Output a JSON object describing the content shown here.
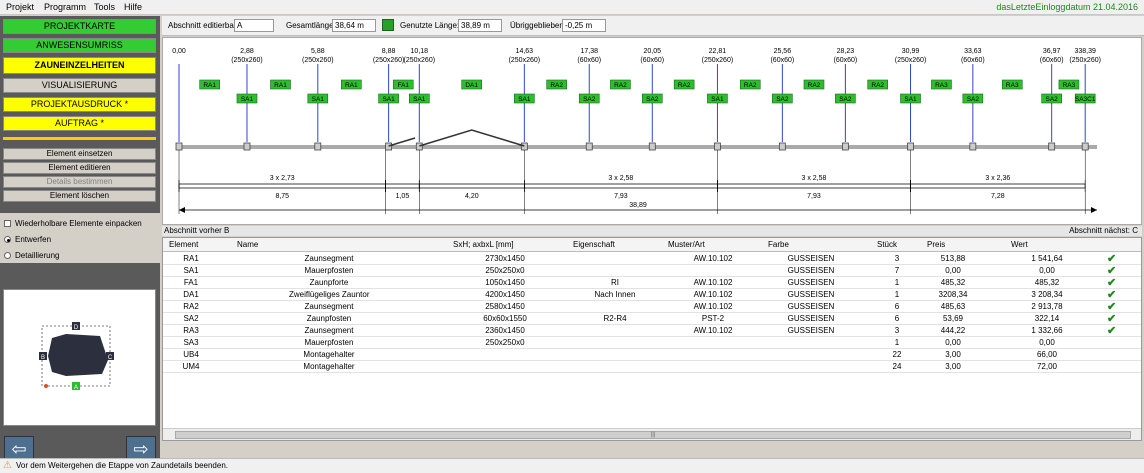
{
  "menu": [
    "Projekt",
    "Programm",
    "Tools",
    "Hilfe"
  ],
  "last_login": "dasLetzteEinloggdatum 21.04.2016",
  "nav": [
    {
      "label": "PROJEKTKARTE",
      "style": "green"
    },
    {
      "label": "ANWESENSUMRISS",
      "style": "green"
    },
    {
      "label": "ZAUNEINZELHEITEN",
      "style": "yellow"
    },
    {
      "label": "VISUALISIERUNG",
      "style": "gray"
    },
    {
      "label": "PROJEKTAUSDRUCK *",
      "style": "yellow"
    },
    {
      "label": "AUFTRAG *",
      "style": "yellow"
    }
  ],
  "actions": [
    {
      "label": "Element einsetzen",
      "disabled": false
    },
    {
      "label": "Element editieren",
      "disabled": false
    },
    {
      "label": "Details bestimmen",
      "disabled": true
    },
    {
      "label": "Element löschen",
      "disabled": false
    }
  ],
  "options": {
    "pack_label": "Wiederholbare Elemente einpacken",
    "draft_label": "Entwerfen",
    "detail_label": "Detaillierung"
  },
  "preview_labels": {
    "top": "D",
    "left": "B",
    "right": "C",
    "bottom": "A"
  },
  "toolbar": {
    "section_label": "Abschnitt editierbar:",
    "section_value": "A",
    "total_label": "Gesamtlänge:",
    "total_value": "38,64 m",
    "used_label": "Genutzte Länge:",
    "used_value": "38,89 m",
    "remaining_label": "Übriggeblieben",
    "remaining_value": "-0,25 m"
  },
  "drawing": {
    "posts": [
      {
        "x": 0.0,
        "label": "0,00",
        "size": ""
      },
      {
        "x": 2.88,
        "label": "2,88",
        "size": "(250x260)"
      },
      {
        "x": 5.88,
        "label": "5,88",
        "size": "(250x260)"
      },
      {
        "x": 8.88,
        "label": "8,88",
        "size": "(250x260)"
      },
      {
        "x": 10.18,
        "label": "10,18",
        "size": "(250x260)"
      },
      {
        "x": 14.63,
        "label": "14,63",
        "size": "(250x260)"
      },
      {
        "x": 17.38,
        "label": "17,38",
        "size": "(60x60)"
      },
      {
        "x": 20.05,
        "label": "20,05",
        "size": "(60x60)"
      },
      {
        "x": 22.81,
        "label": "22,81",
        "size": "(250x260)"
      },
      {
        "x": 25.56,
        "label": "25,56",
        "size": "(60x60)"
      },
      {
        "x": 28.23,
        "label": "28,23",
        "size": "(60x60)"
      },
      {
        "x": 30.99,
        "label": "30,99",
        "size": "(250x260)"
      },
      {
        "x": 33.63,
        "label": "33,63",
        "size": "(60x60)"
      },
      {
        "x": 36.97,
        "label": "36,97",
        "size": "(60x60)"
      },
      {
        "x": 38.39,
        "label": "338,39",
        "size": "(250x260)"
      }
    ],
    "elements": [
      {
        "x": 1.3,
        "row": 0,
        "label": "RA1"
      },
      {
        "x": 2.88,
        "row": 1,
        "label": "SA1"
      },
      {
        "x": 4.3,
        "row": 0,
        "label": "RA1"
      },
      {
        "x": 5.88,
        "row": 1,
        "label": "SA1"
      },
      {
        "x": 7.3,
        "row": 0,
        "label": "RA1"
      },
      {
        "x": 8.88,
        "row": 1,
        "label": "SA1"
      },
      {
        "x": 9.5,
        "row": 0,
        "label": "FA1"
      },
      {
        "x": 10.18,
        "row": 1,
        "label": "SA1"
      },
      {
        "x": 12.4,
        "row": 0,
        "label": "DA1"
      },
      {
        "x": 14.63,
        "row": 1,
        "label": "SA1"
      },
      {
        "x": 16.0,
        "row": 0,
        "label": "RA2"
      },
      {
        "x": 17.38,
        "row": 1,
        "label": "SA2"
      },
      {
        "x": 18.7,
        "row": 0,
        "label": "RA2"
      },
      {
        "x": 20.05,
        "row": 1,
        "label": "SA2"
      },
      {
        "x": 21.4,
        "row": 0,
        "label": "RA2"
      },
      {
        "x": 22.81,
        "row": 1,
        "label": "SA1"
      },
      {
        "x": 24.2,
        "row": 0,
        "label": "RA2"
      },
      {
        "x": 25.56,
        "row": 1,
        "label": "SA2"
      },
      {
        "x": 26.9,
        "row": 0,
        "label": "RA2"
      },
      {
        "x": 28.23,
        "row": 1,
        "label": "SA2"
      },
      {
        "x": 29.6,
        "row": 0,
        "label": "RA2"
      },
      {
        "x": 30.99,
        "row": 1,
        "label": "SA1"
      },
      {
        "x": 32.3,
        "row": 0,
        "label": "RA3"
      },
      {
        "x": 33.63,
        "row": 1,
        "label": "SA2"
      },
      {
        "x": 35.3,
        "row": 0,
        "label": "RA3"
      },
      {
        "x": 36.97,
        "row": 1,
        "label": "SA2"
      },
      {
        "x": 37.7,
        "row": 0,
        "label": "RA3"
      },
      {
        "x": 38.39,
        "row": 1,
        "label": "SA3C1"
      }
    ],
    "dims_row1": [
      {
        "from": 0.0,
        "to": 8.75,
        "label": "3 x 2,73"
      },
      {
        "from": 8.75,
        "to": 10.18,
        "label": ""
      },
      {
        "from": 10.18,
        "to": 14.63,
        "label": ""
      },
      {
        "from": 14.63,
        "to": 22.81,
        "label": "3 x 2,58"
      },
      {
        "from": 22.81,
        "to": 30.99,
        "label": "3 x 2,58"
      },
      {
        "from": 30.99,
        "to": 38.39,
        "label": "3 x 2,36"
      }
    ],
    "dims_row2": [
      {
        "from": 0.0,
        "to": 8.75,
        "label": "8,75"
      },
      {
        "from": 8.75,
        "to": 10.18,
        "label": "1,05"
      },
      {
        "from": 10.18,
        "to": 14.63,
        "label": "4,20"
      },
      {
        "from": 14.63,
        "to": 22.81,
        "label": "7,93"
      },
      {
        "from": 22.81,
        "to": 30.99,
        "label": "7,93"
      },
      {
        "from": 30.99,
        "to": 38.39,
        "label": "7,28"
      }
    ],
    "total": {
      "label": "38,89"
    },
    "max": 38.89
  },
  "section_prev": "Abschnitt vorher B",
  "section_next": "Abschnitt nächst: C",
  "table": {
    "headers": [
      "Element",
      "Name",
      "SxH; axbxL [mm]",
      "Eigenschaft",
      "Muster/Art",
      "Farbe",
      "Stück",
      "Preis",
      "Wert"
    ],
    "rows": [
      {
        "el": "RA1",
        "name": "Zaunsegment",
        "size": "2730x1450",
        "prop": "",
        "pattern": "AW.10.102",
        "color": "GUSSEISEN",
        "qty": "3",
        "price": "513,88",
        "value": "1 541,64",
        "ok": true
      },
      {
        "el": "SA1",
        "name": "Mauerpfosten",
        "size": "250x250x0",
        "prop": "",
        "pattern": "",
        "color": "GUSSEISEN",
        "qty": "7",
        "price": "0,00",
        "value": "0,00",
        "ok": true
      },
      {
        "el": "FA1",
        "name": "Zaunpforte",
        "size": "1050x1450",
        "prop": "RI",
        "pattern": "AW.10.102",
        "color": "GUSSEISEN",
        "qty": "1",
        "price": "485,32",
        "value": "485,32",
        "ok": true
      },
      {
        "el": "DA1",
        "name": "Zweiflügeliges Zauntor",
        "size": "4200x1450",
        "prop": "Nach Innen",
        "pattern": "AW.10.102",
        "color": "GUSSEISEN",
        "qty": "1",
        "price": "3208,34",
        "value": "3 208,34",
        "ok": true
      },
      {
        "el": "RA2",
        "name": "Zaunsegment",
        "size": "2580x1450",
        "prop": "",
        "pattern": "AW.10.102",
        "color": "GUSSEISEN",
        "qty": "6",
        "price": "485,63",
        "value": "2 913,78",
        "ok": true
      },
      {
        "el": "SA2",
        "name": "Zaunpfosten",
        "size": "60x60x1550",
        "prop": "R2-R4",
        "pattern": "PST-2",
        "color": "GUSSEISEN",
        "qty": "6",
        "price": "53,69",
        "value": "322,14",
        "ok": true
      },
      {
        "el": "RA3",
        "name": "Zaunsegment",
        "size": "2360x1450",
        "prop": "",
        "pattern": "AW.10.102",
        "color": "GUSSEISEN",
        "qty": "3",
        "price": "444,22",
        "value": "1 332,66",
        "ok": true
      },
      {
        "el": "SA3",
        "name": "Mauerpfosten",
        "size": "250x250x0",
        "prop": "",
        "pattern": "",
        "color": "",
        "qty": "1",
        "price": "0,00",
        "value": "0,00",
        "ok": false
      },
      {
        "el": "UB4",
        "name": "Montagehalter",
        "size": "",
        "prop": "",
        "pattern": "",
        "color": "",
        "qty": "22",
        "price": "3,00",
        "value": "66,00",
        "ok": false
      },
      {
        "el": "UM4",
        "name": "Montagehalter",
        "size": "",
        "prop": "",
        "pattern": "",
        "color": "",
        "qty": "24",
        "price": "3,00",
        "value": "72,00",
        "ok": false
      }
    ]
  },
  "status_text": "Vor dem Weitergehen die Etappe von Zaundetails beenden.",
  "colors": {
    "accent_green": "#33cc33",
    "accent_yellow": "#ffff00",
    "element_green": "#2ebd2e",
    "post_blue": "#3344cc"
  }
}
